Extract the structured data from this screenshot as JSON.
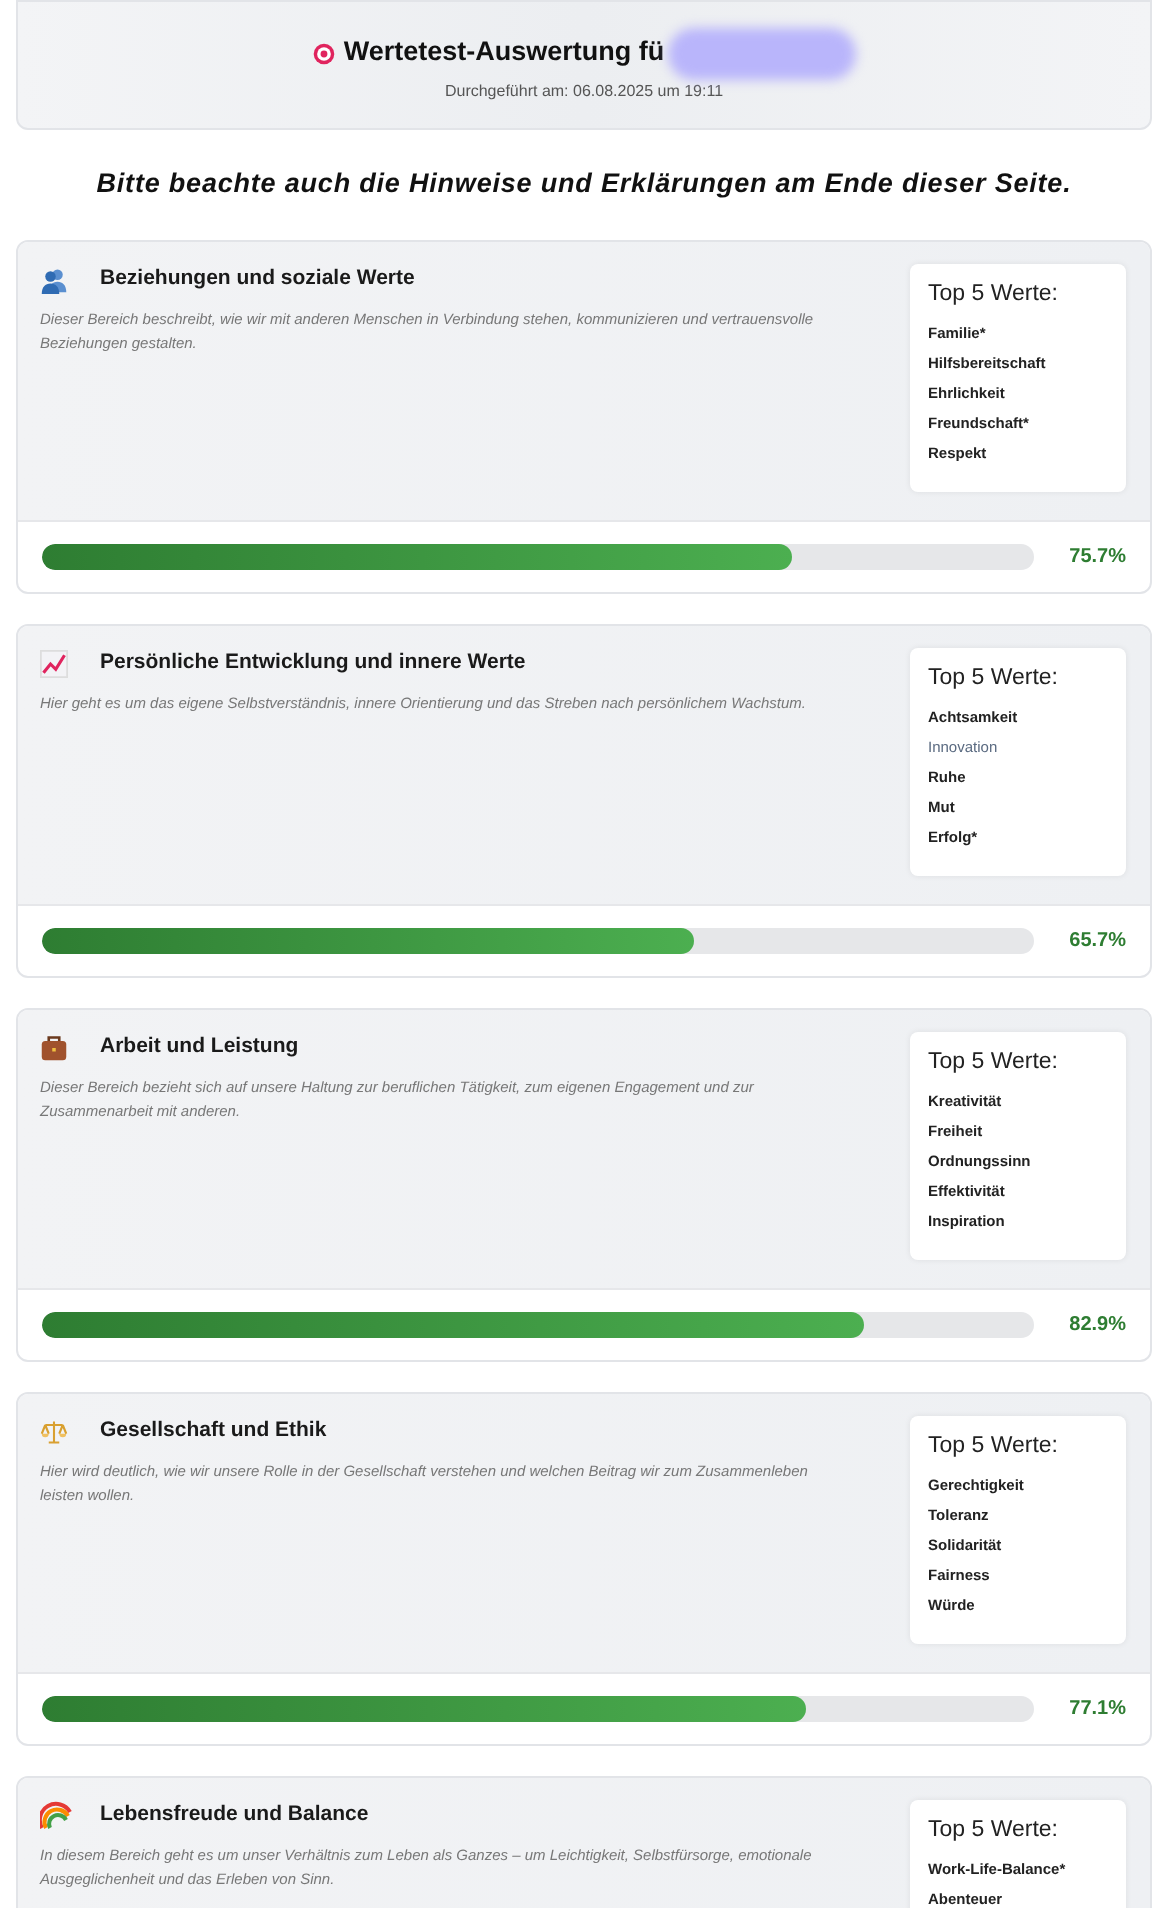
{
  "header": {
    "title": "Wertetest-Auswertung fü",
    "subtitle": "Durchgeführt am: 06.08.2025 um 19:11"
  },
  "notice": "Bitte beachte auch die Hinweise und Erklärungen am Ende dieser Seite.",
  "categories": [
    {
      "kind": "people",
      "title": "Beziehungen und soziale Werte",
      "description": "Dieser Bereich beschreibt, wie wir mit anderen Menschen in Verbindung stehen, kommunizieren und vertrauensvolle Beziehungen gestalten.",
      "top_heading": "Top 5 Werte:",
      "values": [
        {
          "label": "Familie*",
          "muted": false
        },
        {
          "label": "Hilfsbereitschaft",
          "muted": false
        },
        {
          "label": "Ehrlichkeit",
          "muted": false
        },
        {
          "label": "Freundschaft*",
          "muted": false
        },
        {
          "label": "Respekt",
          "muted": false
        }
      ],
      "level": 0.757,
      "percent": "75.7%"
    },
    {
      "kind": "chart",
      "title": "Persönliche Entwicklung und innere Werte",
      "description": "Hier geht es um das eigene Selbstverständnis, innere Orientierung und das Streben nach persönlichem Wachstum.",
      "top_heading": "Top 5 Werte:",
      "values": [
        {
          "label": "Achtsamkeit",
          "muted": false
        },
        {
          "label": "Innovation",
          "muted": true
        },
        {
          "label": "Ruhe",
          "muted": false
        },
        {
          "label": "Mut",
          "muted": false
        },
        {
          "label": "Erfolg*",
          "muted": false
        }
      ],
      "level": 0.657,
      "percent": "65.7%"
    },
    {
      "kind": "briefcase",
      "title": "Arbeit und Leistung",
      "description": "Dieser Bereich bezieht sich auf unsere Haltung zur beruflichen Tätigkeit, zum eigenen Engagement und zur Zusammenarbeit mit anderen.",
      "top_heading": "Top 5 Werte:",
      "values": [
        {
          "label": "Kreativität",
          "muted": false
        },
        {
          "label": "Freiheit",
          "muted": false
        },
        {
          "label": "Ordnungssinn",
          "muted": false
        },
        {
          "label": "Effektivität",
          "muted": false
        },
        {
          "label": "Inspiration",
          "muted": false
        }
      ],
      "level": 0.829,
      "percent": "82.9%"
    },
    {
      "kind": "scales",
      "title": "Gesellschaft und Ethik",
      "description": "Hier wird deutlich, wie wir unsere Rolle in der Gesellschaft verstehen und welchen Beitrag wir zum Zusammenleben leisten wollen.",
      "top_heading": "Top 5 Werte:",
      "values": [
        {
          "label": "Gerechtigkeit",
          "muted": false
        },
        {
          "label": "Toleranz",
          "muted": false
        },
        {
          "label": "Solidarität",
          "muted": false
        },
        {
          "label": "Fairness",
          "muted": false
        },
        {
          "label": "Würde",
          "muted": false
        }
      ],
      "level": 0.771,
      "percent": "77.1%"
    },
    {
      "kind": "rainbow",
      "title": "Lebensfreude und Balance",
      "description": "In diesem Bereich geht es um unser Verhältnis zum Leben als Ganzes – um Leichtigkeit, Selbstfürsorge, emotionale Ausgeglichenheit und das Erleben von Sinn.",
      "top_heading": "Top 5 Werte:",
      "values": [
        {
          "label": "Work-Life-Balance*",
          "muted": false
        },
        {
          "label": "Abenteuer",
          "muted": false
        }
      ]
    }
  ]
}
